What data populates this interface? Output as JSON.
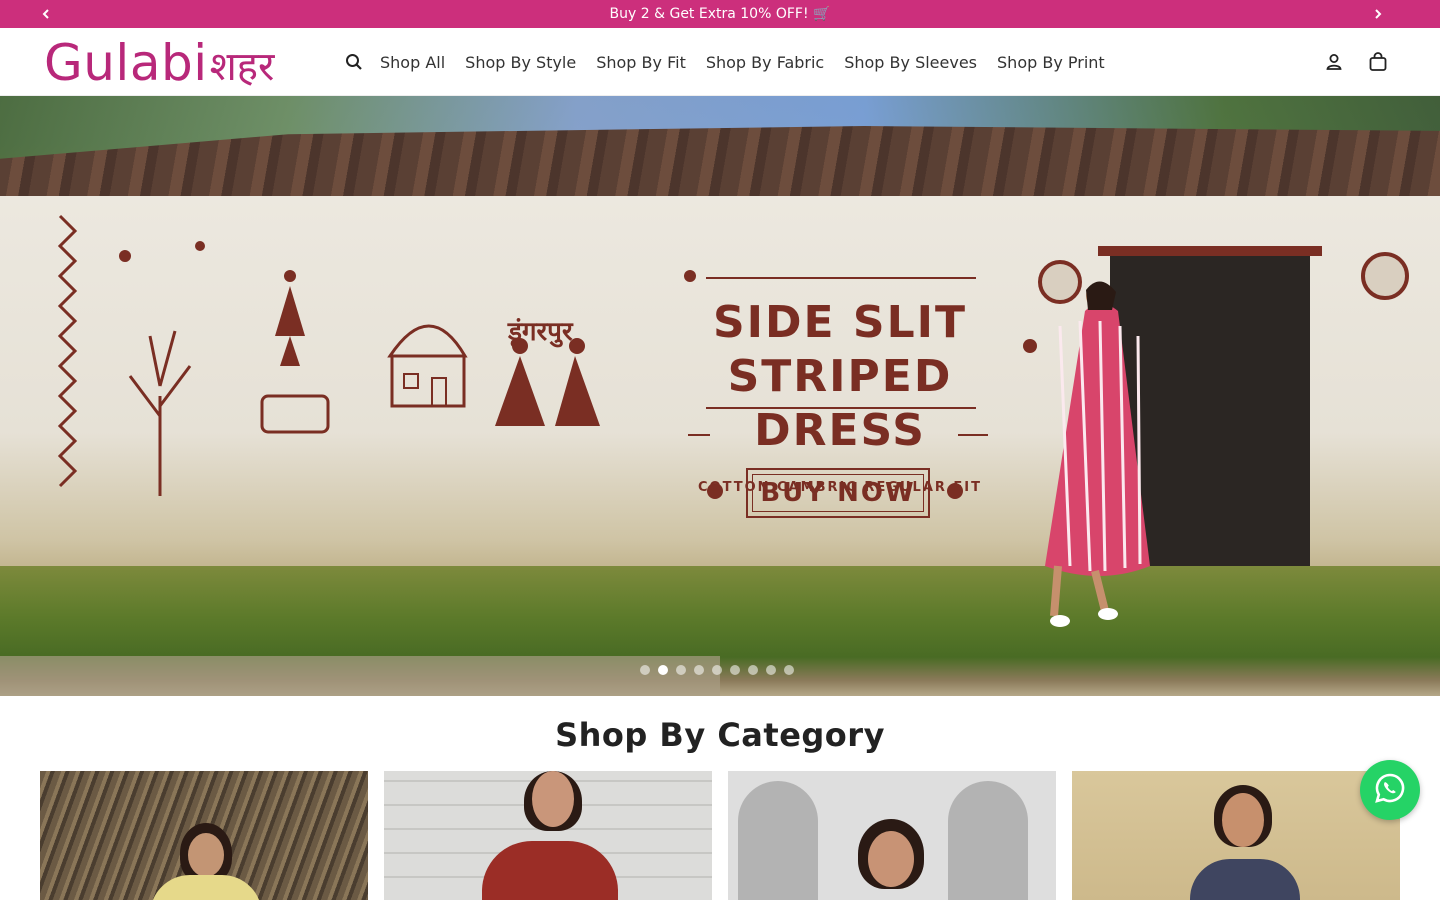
{
  "announcement": {
    "text": "Buy 2 & Get Extra 10% OFF! 🛒",
    "prev_icon": "chevron-left-icon",
    "next_icon": "chevron-right-icon",
    "background": "#cc2f7c"
  },
  "header": {
    "logo_latin": "Gulabi",
    "logo_devanagari": "शहर",
    "logo_color": "#b8287a",
    "search_icon": "search-icon",
    "nav": [
      {
        "label": "Shop All"
      },
      {
        "label": "Shop By Style"
      },
      {
        "label": "Shop By Fit"
      },
      {
        "label": "Shop By Fabric"
      },
      {
        "label": "Shop By Sleeves"
      },
      {
        "label": "Shop By Print"
      }
    ],
    "account_icon": "user-icon",
    "cart_icon": "bag-icon"
  },
  "hero": {
    "wall_text": "डूंगरपुर",
    "title_line1": "SIDE SLIT",
    "title_line2": "STRIPED DRESS",
    "subtitle": "COTTON CAMBRIC REGULAR FIT",
    "cta": "BUY NOW",
    "accent": "#7a2e23",
    "slide_count": 9,
    "active_slide": 2
  },
  "category_section": {
    "title": "Shop By Category",
    "cards": [
      {
        "name": "category-card-1"
      },
      {
        "name": "category-card-2"
      },
      {
        "name": "category-card-3"
      },
      {
        "name": "category-card-4"
      }
    ]
  },
  "whatsapp": {
    "icon": "whatsapp-icon",
    "color": "#25d366"
  }
}
